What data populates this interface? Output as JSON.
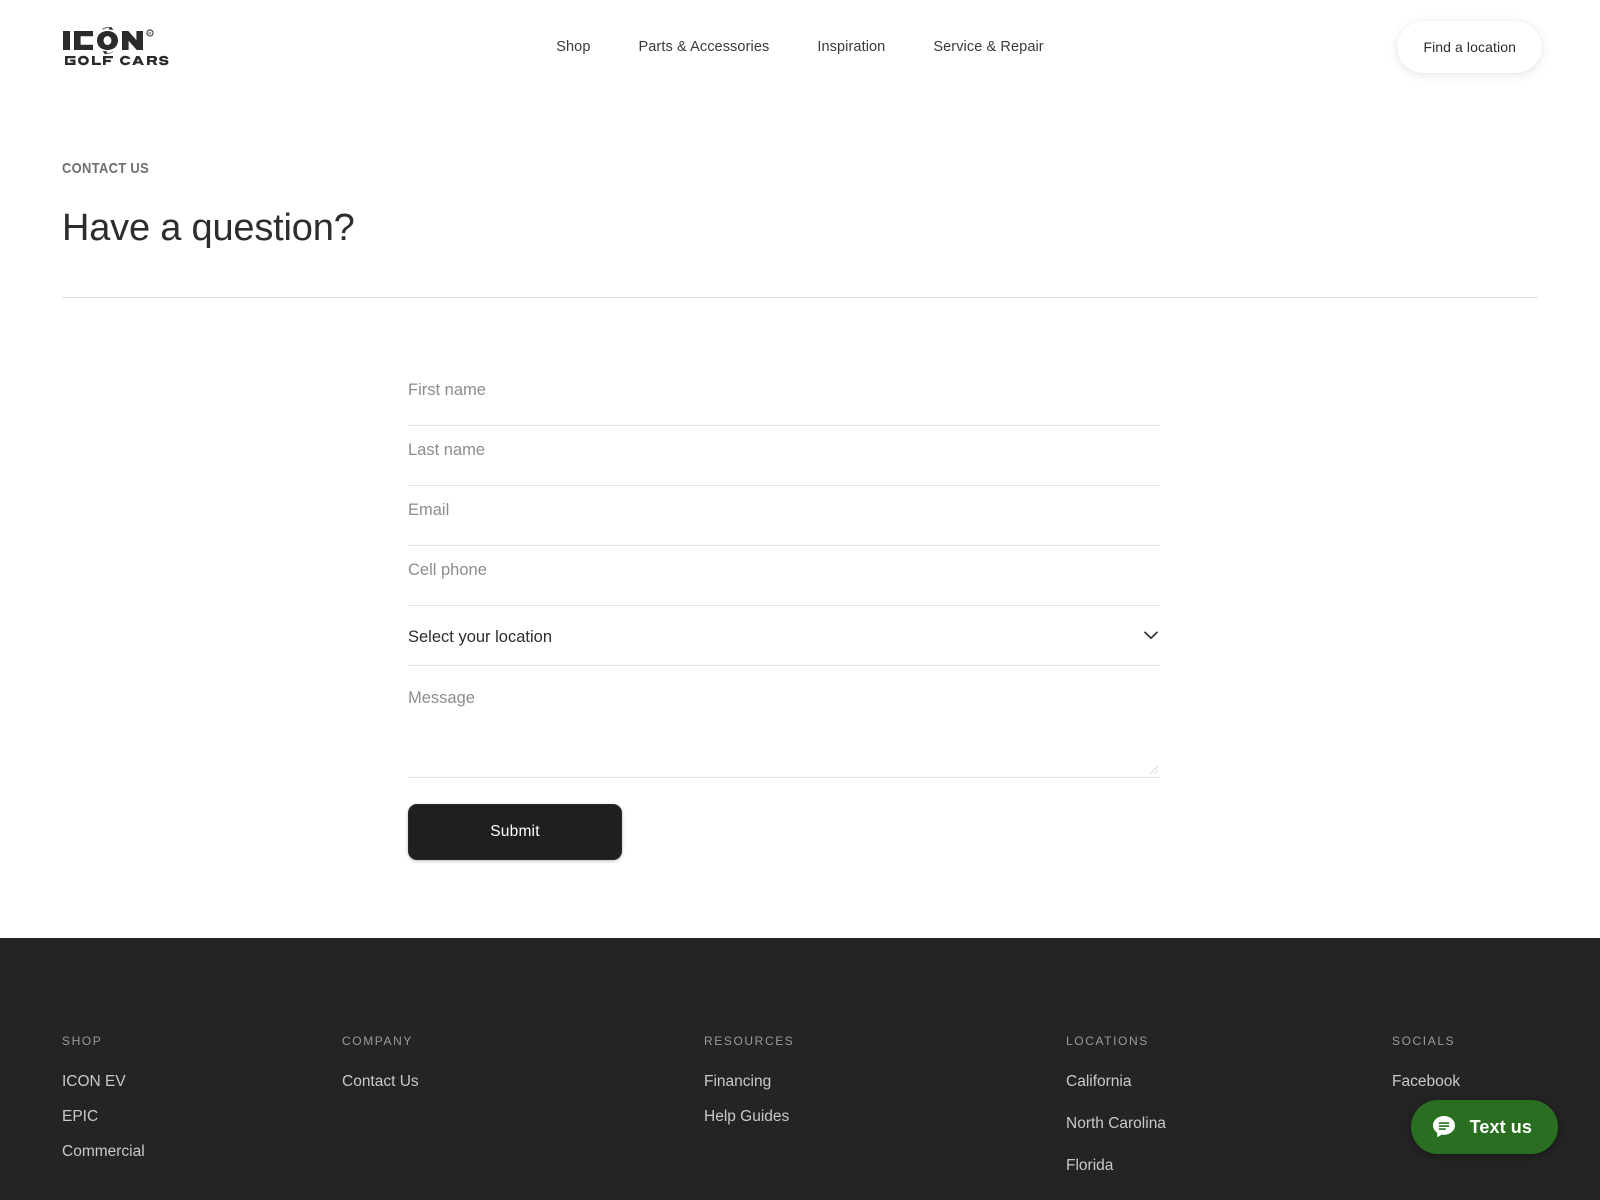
{
  "header": {
    "logo": {
      "name": "icon-golf-cars-logo",
      "primary_text": "ICON",
      "secondary_text": "GOLF CARS",
      "trademark": "®"
    },
    "nav": [
      {
        "label": "Shop",
        "name": "nav-item-shop"
      },
      {
        "label": "Parts & Accessories",
        "name": "nav-item-parts-accessories"
      },
      {
        "label": "Inspiration",
        "name": "nav-item-inspiration"
      },
      {
        "label": "Service & Repair",
        "name": "nav-item-service-repair"
      }
    ],
    "find_location_label": "Find a location"
  },
  "hero": {
    "eyebrow": "CONTACT US",
    "title": "Have a question?"
  },
  "form": {
    "fields": {
      "first_name": {
        "placeholder": "First name",
        "value": ""
      },
      "last_name": {
        "placeholder": "Last name",
        "value": ""
      },
      "email": {
        "placeholder": "Email",
        "value": ""
      },
      "cell_phone": {
        "placeholder": "Cell phone",
        "value": ""
      },
      "message": {
        "placeholder": "Message",
        "value": ""
      }
    },
    "location_select": {
      "selected": "Select your location",
      "icon": "chevron-down-icon"
    },
    "submit_label": "Submit"
  },
  "footer": {
    "columns": [
      {
        "title": "SHOP",
        "key": "shop",
        "links": [
          "ICON EV",
          "EPIC",
          "Commercial"
        ]
      },
      {
        "title": "COMPANY",
        "key": "company",
        "links": [
          "Contact Us"
        ]
      },
      {
        "title": "RESOURCES",
        "key": "resources",
        "links": [
          "Financing",
          "Help Guides"
        ]
      },
      {
        "title": "LOCATIONS",
        "key": "locations",
        "links": [
          "California",
          "North Carolina",
          "Florida"
        ]
      },
      {
        "title": "SOCIALS",
        "key": "socials",
        "links": [
          "Facebook"
        ]
      }
    ]
  },
  "chat_widget": {
    "label": "Text us",
    "icon": "chat-bubble-icon",
    "color": "#2a6e22"
  },
  "colors": {
    "page_background": "#ffffff",
    "footer_background": "#242424",
    "text_primary": "#2d2d2d",
    "text_muted": "#8d8d8d",
    "footer_heading": "#9a9a9a",
    "footer_link": "#c9c9c9",
    "field_underline": "#e3e3e3",
    "divider": "#dedede",
    "submit_background": "#1f1f1f",
    "chat_green": "#2a6e22"
  }
}
